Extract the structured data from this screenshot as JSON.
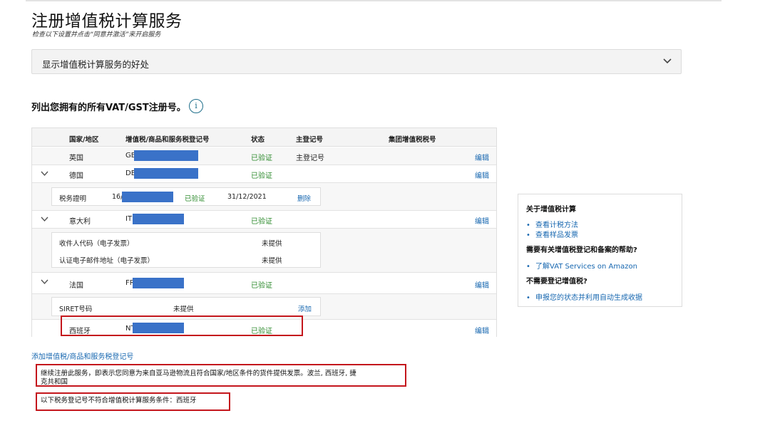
{
  "page": {
    "title": "注册增值税计算服务",
    "subtitle": "检查以下设置并点击“同意并激活”来开启服务"
  },
  "benefits": {
    "label": "显示增值税计算服务的好处"
  },
  "registrations": {
    "title": "列出您拥有的所有VAT/GST注册号。",
    "info_icon_glyph": "i",
    "headers": {
      "country": "国家/地区",
      "number": "增值税/商品和服务税登记号",
      "status": "状态",
      "primary": "主登记号",
      "group": "集团增值税税号"
    },
    "rows": [
      {
        "country": "英国",
        "prefix": "GB",
        "status": "已验证",
        "primary": "主登记号",
        "action": "编辑"
      },
      {
        "country": "德国",
        "prefix": "DE",
        "status": "已验证",
        "primary": "",
        "action": "编辑"
      },
      {
        "country": "意大利",
        "prefix": "IT",
        "status": "已验证",
        "primary": "",
        "action": "编辑"
      },
      {
        "country": "法国",
        "prefix": "FR",
        "status": "已验证",
        "primary": "",
        "action": "编辑"
      },
      {
        "country": "西班牙",
        "prefix": "NT",
        "status": "已验证",
        "primary": "",
        "action": "编辑"
      }
    ],
    "germany_detail": {
      "label": "税务證明",
      "prefix": "16/",
      "status": "已验证",
      "date": "31/12/2021",
      "action": "删除"
    },
    "italy_detail": [
      {
        "label": "收件人代码（电子发票）",
        "value": "未提供"
      },
      {
        "label": "认证电子邮件地址（电子发票）",
        "value": "未提供"
      }
    ],
    "france_detail": {
      "label": "SIRET号码",
      "value": "未提供",
      "action": "添加"
    },
    "redaction_color": "#3a72c8",
    "verified_color": "#2e8b2e",
    "link_color": "#1767b0",
    "highlight_color": "#c4161c"
  },
  "add_link": "添加增值税/商品和服务税登记号",
  "notices": {
    "consent_line1": "继续注册此服务，即表示您同意为来自亚马逊物流且符合国家/地区条件的货件提供发票。波兰, 西班牙, 捷",
    "consent_line2": "克共和国",
    "ineligible": "以下税务登记号不符合增值税计算服务条件：西班牙"
  },
  "sidebar": {
    "heading1": "关于增值税计算",
    "link1": "查看计税方法",
    "link2": "查看样品发票",
    "heading2": "需要有关增值税登记和备案的帮助?",
    "link3": "了解VAT Services on Amazon",
    "heading3": "不需要登记增值税?",
    "link4": "申报您的状态并利用自动生成收据",
    "bullet": "•"
  }
}
